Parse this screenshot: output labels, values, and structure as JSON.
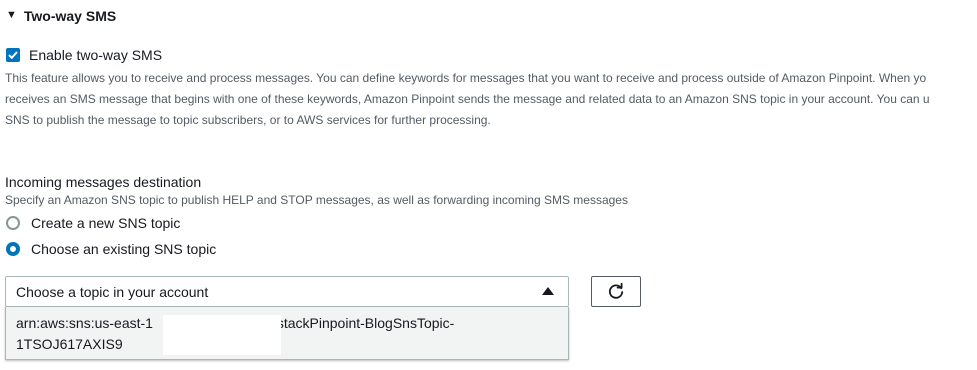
{
  "section": {
    "title": "Two-way SMS",
    "caret_icon": "caret-down-icon"
  },
  "two_way": {
    "checkbox_label": "Enable two-way SMS",
    "checked": true,
    "description_lines": [
      "This feature allows you to receive and process messages. You can define keywords for messages that you want to receive and process outside of Amazon Pinpoint. When yo",
      "receives an SMS message that begins with one of these keywords, Amazon Pinpoint sends the message and related data to an Amazon SNS topic in your account. You can u",
      "SNS to publish the message to topic subscribers, or to AWS services for further processing."
    ]
  },
  "destination": {
    "label": "Incoming messages destination",
    "description": "Specify an Amazon SNS topic to publish HELP and STOP messages, as well as forwarding incoming SMS messages",
    "options": [
      {
        "label": "Create a new SNS topic",
        "selected": false
      },
      {
        "label": "Choose an existing SNS topic",
        "selected": true
      }
    ]
  },
  "topic_select": {
    "value": "Choose a topic in your account",
    "arrow_icon": "caret-up-icon",
    "refresh_icon": "refresh-icon",
    "dropdown_option_line1": "arn:aws:sns:us-east-1",
    "dropdown_option_line1_suffix": ":BlogstackPinpoint-BlogSnsTopic-",
    "dropdown_option_line2": "1TSOJ617AXIS9"
  },
  "colors": {
    "accent": "#0073bb",
    "text": "#16191f",
    "muted_text": "#545b64",
    "border": "#aab7b8",
    "dropdown_bg": "#f2f3f3"
  }
}
